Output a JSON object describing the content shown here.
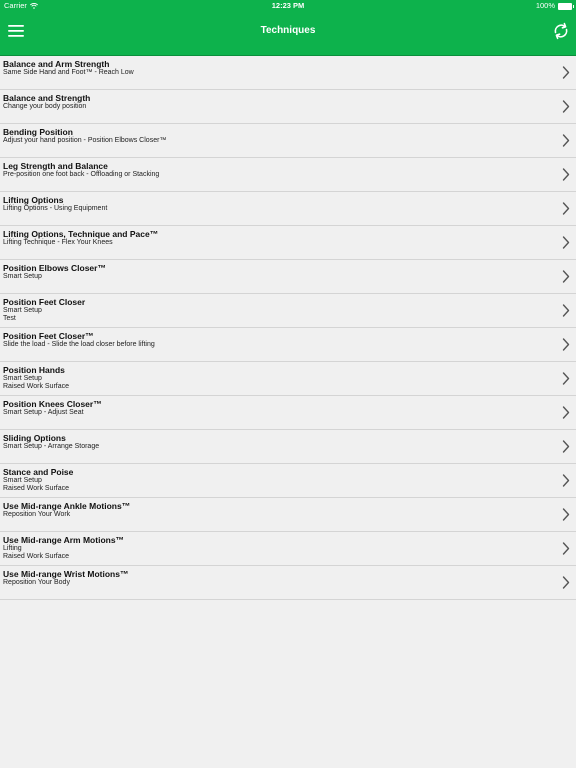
{
  "status_bar": {
    "carrier": "Carrier",
    "time": "12:23 PM",
    "battery": "100%",
    "battery_level": 1.0
  },
  "nav": {
    "title": "Techniques",
    "menu_icon": "hamburger-menu-icon",
    "refresh_icon": "refresh-icon"
  },
  "colors": {
    "nav_background": "#0db24c",
    "list_background": "#f0f0f0",
    "separator": "#d4d4d4",
    "chevron": "#555555"
  },
  "items": [
    {
      "title": "Balance and Arm Strength",
      "subtitles": [
        "Same Side Hand and Foot™ - Reach Low"
      ]
    },
    {
      "title": "Balance and Strength",
      "subtitles": [
        "Change your body position"
      ]
    },
    {
      "title": "Bending Position",
      "subtitles": [
        "Adjust your hand position - Position Elbows Closer™"
      ]
    },
    {
      "title": "Leg Strength and Balance",
      "subtitles": [
        "Pre-position one foot back - Offloading or Stacking"
      ]
    },
    {
      "title": "Lifting Options",
      "subtitles": [
        "Lifting Options - Using Equipment"
      ]
    },
    {
      "title": "Lifting Options, Technique and Pace™",
      "subtitles": [
        "Lifting Technique - Flex Your Knees"
      ]
    },
    {
      "title": "Position Elbows Closer™",
      "subtitles": [
        "Smart Setup"
      ]
    },
    {
      "title": "Position Feet Closer",
      "subtitles": [
        "Smart Setup",
        "Test"
      ]
    },
    {
      "title": "Position Feet Closer™",
      "subtitles": [
        "Slide the load - Slide the load closer before lifting"
      ]
    },
    {
      "title": "Position Hands",
      "subtitles": [
        "Smart Setup",
        "Raised Work Surface"
      ]
    },
    {
      "title": "Position Knees Closer™",
      "subtitles": [
        "Smart Setup - Adjust Seat"
      ]
    },
    {
      "title": "Sliding Options",
      "subtitles": [
        "Smart Setup - Arrange Storage"
      ]
    },
    {
      "title": "Stance and Poise",
      "subtitles": [
        "Smart Setup",
        "Raised Work Surface"
      ]
    },
    {
      "title": "Use Mid-range Ankle Motions™",
      "subtitles": [
        "Reposition Your Work"
      ]
    },
    {
      "title": "Use Mid-range Arm Motions™",
      "subtitles": [
        "Lifting",
        "Raised Work Surface"
      ]
    },
    {
      "title": "Use Mid-range Wrist Motions™",
      "subtitles": [
        "Reposition Your Body"
      ]
    }
  ]
}
